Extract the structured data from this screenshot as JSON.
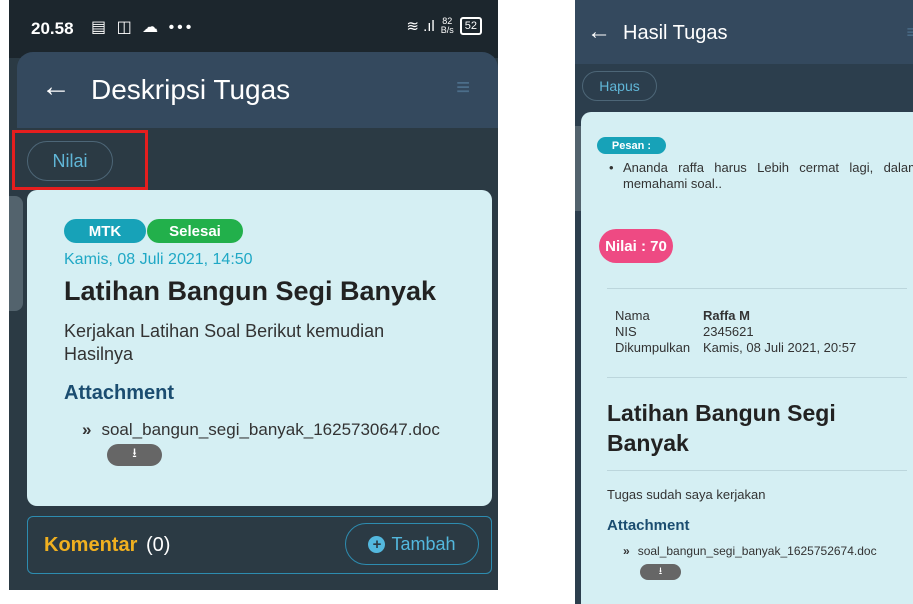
{
  "left": {
    "status": {
      "time": "20.58",
      "icons": "▤ ◫ ☁ •••",
      "signal": "≋ .ıl",
      "speed_top": "82",
      "speed_bottom": "B/s",
      "battery": "52"
    },
    "appbar": {
      "back_icon": "←",
      "title": "Deskripsi Tugas",
      "menu_icon": "≡"
    },
    "nilai_button": "Nilai",
    "card": {
      "subject_badge": "MTK",
      "status_badge": "Selesai",
      "date": "Kamis, 08 Juli 2021, 14:50",
      "title": "Latihan Bangun Segi Banyak",
      "description": "Kerjakan Latihan Soal  Berikut kemudian Hasilnya",
      "attachment_label": "Attachment",
      "file_chevron": "»",
      "file_name": "soal_bangun_segi_banyak_1625730647.doc",
      "download_icon": "⭳"
    },
    "komentar": {
      "label": "Komentar",
      "count": "(0)",
      "add_icon": "+",
      "add_label": "Tambah"
    }
  },
  "right": {
    "appbar": {
      "back_icon": "←",
      "title": "Hasil Tugas",
      "menu_icon": "≡"
    },
    "hapus_button": "Hapus",
    "card": {
      "pesan_badge": "Pesan :",
      "bullet": "•",
      "pesan_text": "Ananda raffa harus Lebih cermat lagi, dalam memahami soal..",
      "nilai_badge": "Nilai : 70",
      "info": [
        {
          "key": "Nama",
          "value": "Raffa M"
        },
        {
          "key": "NIS",
          "value": "2345621"
        },
        {
          "key": "Dikumpulkan",
          "value": "Kamis, 08 Juli 2021, 20:57"
        }
      ],
      "title": "Latihan Bangun Segi Banyak",
      "description": "Tugas sudah saya kerjakan",
      "attachment_label": "Attachment",
      "file_chevron": "»",
      "file_name": "soal_bangun_segi_banyak_1625752674.doc",
      "download_icon": "⭳"
    }
  },
  "colors": {
    "highlight_box": "#e51e1e",
    "nilai_badge": "#ee4a83",
    "selesai_badge": "#22b04b",
    "mtk_badge": "#17a2b8",
    "komentar_label": "#f0b020"
  }
}
